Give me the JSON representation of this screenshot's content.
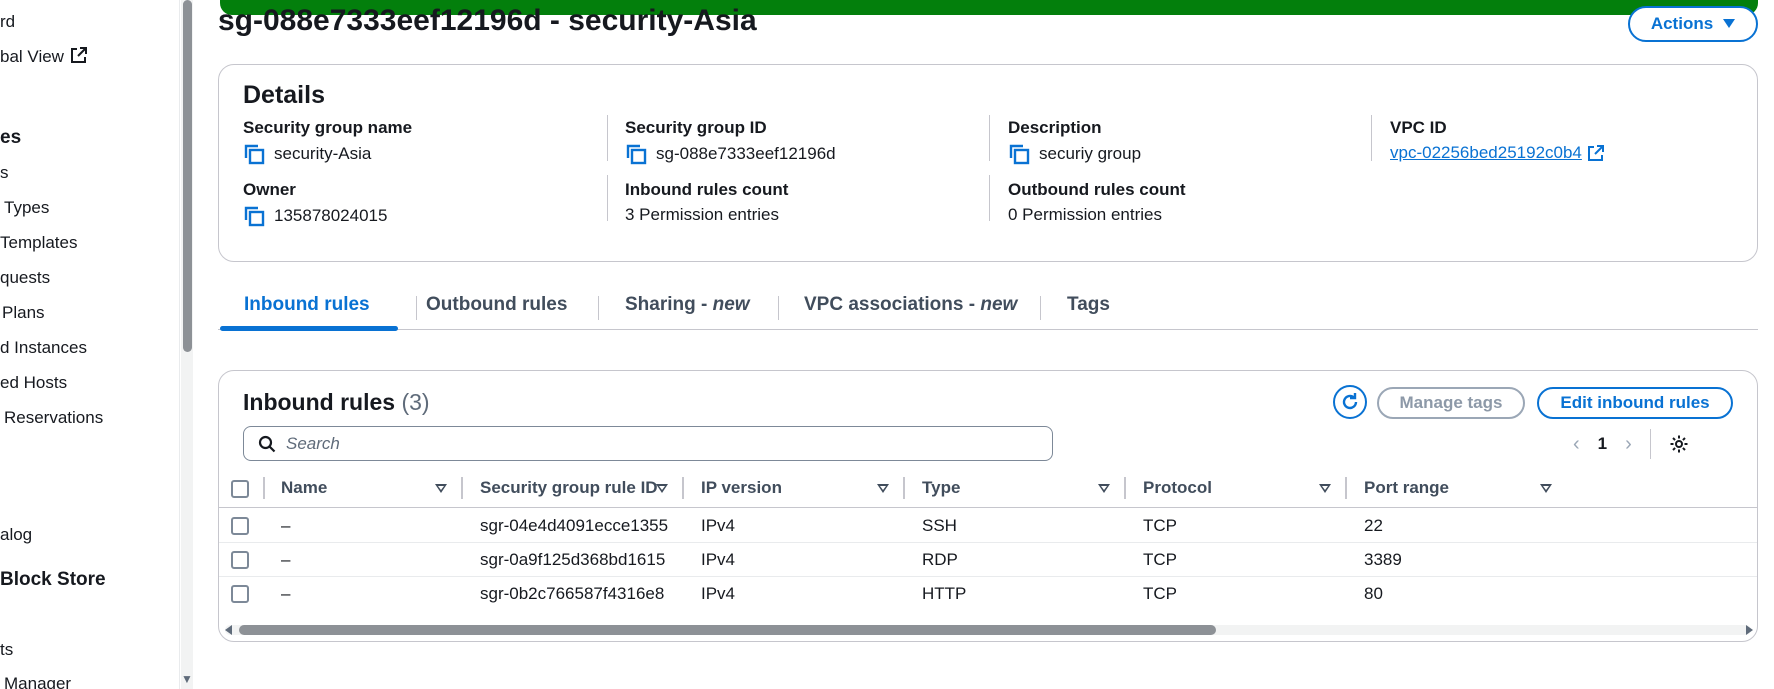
{
  "sidebar": {
    "items": [
      {
        "label": "rd"
      },
      {
        "label": "bal View"
      },
      {
        "label": "es"
      },
      {
        "label": "s"
      },
      {
        "label": "Types"
      },
      {
        "label": "Templates"
      },
      {
        "label": "quests"
      },
      {
        "label": "Plans"
      },
      {
        "label": "d Instances"
      },
      {
        "label": "ed Hosts"
      },
      {
        "label": "Reservations"
      },
      {
        "label": "alog"
      },
      {
        "label": "Block Store"
      },
      {
        "label": "ts"
      },
      {
        "label": "Manager"
      }
    ]
  },
  "header": {
    "title": "sg-088e7333eef12196d - security-Asia",
    "actions_label": "Actions"
  },
  "details": {
    "heading": "Details",
    "security_group_name_label": "Security group name",
    "security_group_name": "security-Asia",
    "security_group_id_label": "Security group ID",
    "security_group_id": "sg-088e7333eef12196d",
    "description_label": "Description",
    "description": "securiy group",
    "vpc_id_label": "VPC ID",
    "vpc_id": "vpc-02256bed25192c0b4",
    "owner_label": "Owner",
    "owner": "135878024015",
    "inbound_count_label": "Inbound rules count",
    "inbound_count": "3 Permission entries",
    "outbound_count_label": "Outbound rules count",
    "outbound_count": "0 Permission entries"
  },
  "tabs": [
    {
      "label": "Inbound rules"
    },
    {
      "label": "Outbound rules"
    },
    {
      "label": "Sharing - ",
      "suffix": "new"
    },
    {
      "label": "VPC associations - ",
      "suffix": "new"
    },
    {
      "label": "Tags"
    }
  ],
  "inbound": {
    "heading": "Inbound rules",
    "count": "(3)",
    "manage_tags_label": "Manage tags",
    "edit_label": "Edit inbound rules",
    "search_placeholder": "Search",
    "page": "1",
    "columns": [
      "Name",
      "Security group rule ID",
      "IP version",
      "Type",
      "Protocol",
      "Port range"
    ],
    "rows": [
      {
        "name": "–",
        "rule_id": "sgr-04e4d4091ecce1355",
        "ip_version": "IPv4",
        "type": "SSH",
        "protocol": "TCP",
        "port_range": "22"
      },
      {
        "name": "–",
        "rule_id": "sgr-0a9f125d368bd1615",
        "ip_version": "IPv4",
        "type": "RDP",
        "protocol": "TCP",
        "port_range": "3389"
      },
      {
        "name": "–",
        "rule_id": "sgr-0b2c766587f4316e8",
        "ip_version": "IPv4",
        "type": "HTTP",
        "protocol": "TCP",
        "port_range": "80"
      }
    ]
  },
  "colors": {
    "accent": "#0972d3",
    "success_banner": "#037f0c",
    "text": "#16191f"
  }
}
